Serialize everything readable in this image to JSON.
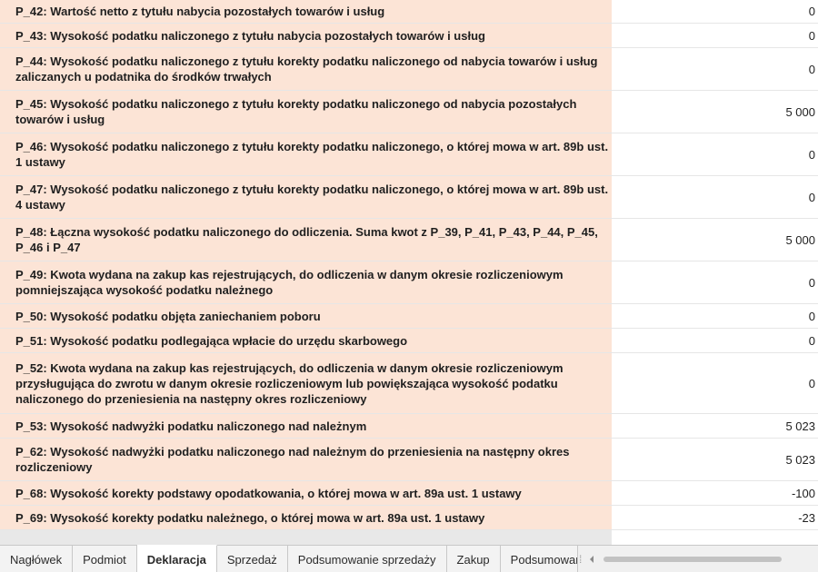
{
  "rows": [
    {
      "label": "P_42: Wartość netto z tytułu nabycia pozostałych towarów i usług",
      "value": "0"
    },
    {
      "label": "P_43: Wysokość podatku naliczonego z tytułu nabycia pozostałych towarów i usług",
      "value": "0"
    },
    {
      "label": "P_44: Wysokość podatku naliczonego z tytułu korekty podatku naliczonego od nabycia towarów i usług zaliczanych u podatnika do środków trwałych",
      "value": "0"
    },
    {
      "label": "P_45: Wysokość podatku naliczonego z tytułu korekty podatku naliczonego od nabycia pozostałych towarów i usług",
      "value": "5 000"
    },
    {
      "label": "P_46: Wysokość podatku naliczonego z tytułu korekty podatku naliczonego, o której mowa w art. 89b ust. 1 ustawy",
      "value": "0"
    },
    {
      "label": "P_47: Wysokość podatku naliczonego z tytułu korekty podatku naliczonego, o której mowa w art. 89b ust. 4 ustawy",
      "value": "0"
    },
    {
      "label": "P_48: Łączna wysokość podatku naliczonego do odliczenia. Suma kwot z P_39, P_41, P_43, P_44, P_45, P_46 i P_47",
      "value": "5 000"
    },
    {
      "label": "P_49: Kwota wydana na zakup kas rejestrujących, do odliczenia w danym okresie rozliczeniowym pomniejszająca wysokość podatku należnego",
      "value": "0"
    },
    {
      "label": "P_50: Wysokość podatku objęta zaniechaniem poboru",
      "value": "0"
    },
    {
      "label": "P_51: Wysokość podatku podlegająca wpłacie do urzędu skarbowego",
      "value": "0"
    },
    {
      "label": "P_52: Kwota wydana na zakup kas rejestrujących, do odliczenia w danym okresie rozliczeniowym przysługująca do zwrotu w danym okresie rozliczeniowym lub powiększająca wysokość podatku naliczonego do przeniesienia na następny okres rozliczeniowy",
      "value": "0"
    },
    {
      "label": "P_53: Wysokość nadwyżki podatku naliczonego nad należnym",
      "value": "5 023"
    },
    {
      "label": "P_62: Wysokość nadwyżki podatku naliczonego nad należnym do przeniesienia na następny okres rozliczeniowy",
      "value": "5 023"
    },
    {
      "label": "P_68: Wysokość korekty podstawy opodatkowania, o której mowa w art. 89a ust. 1 ustawy",
      "value": "-100"
    },
    {
      "label": "P_69: Wysokość korekty podatku należnego, o której mowa w art. 89a ust. 1 ustawy",
      "value": "-23"
    }
  ],
  "tabs": [
    {
      "label": "Nagłówek",
      "active": false
    },
    {
      "label": "Podmiot",
      "active": false
    },
    {
      "label": "Deklaracja",
      "active": true
    },
    {
      "label": "Sprzedaż",
      "active": false
    },
    {
      "label": "Podsumowanie sprzedaży",
      "active": false
    },
    {
      "label": "Zakup",
      "active": false
    },
    {
      "label": "Podsumowanie zakupu",
      "active": false
    }
  ],
  "colors": {
    "label_background": "#fce4d6",
    "active_tab": "#ffffff",
    "tab_background": "#f3f3f3"
  },
  "icons": {
    "scroll_left": "caret-left-icon",
    "tab_splitter": "grip-icon"
  }
}
